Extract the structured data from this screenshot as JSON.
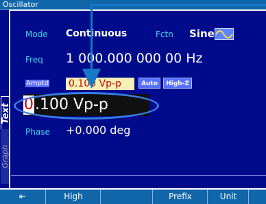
{
  "title": "Oscillator",
  "tabs": {
    "text": "Text",
    "graph": "Graph"
  },
  "mode": {
    "label": "Mode",
    "value": "Continuous"
  },
  "function": {
    "label": "Fctn",
    "value": "Sine"
  },
  "freq": {
    "label": "Freq",
    "value": "1 000.000 000 00 Hz"
  },
  "amplitude": {
    "label": "Amptd",
    "value": "0.100 Vp-p",
    "badges": [
      "Auto",
      "High-Z"
    ]
  },
  "entry": {
    "cursor_digit": "0",
    "rest": ".100 Vp-p"
  },
  "phase": {
    "label": "Phase",
    "value": "+0.000 deg"
  },
  "softkeys": [
    "⇤",
    "High",
    "",
    "Prefix",
    "Unit",
    ""
  ],
  "colors": {
    "panel": "#000b8c",
    "label": "#3fd6e6",
    "accent": "#1166aa",
    "highlight": "#3a7ee6"
  }
}
